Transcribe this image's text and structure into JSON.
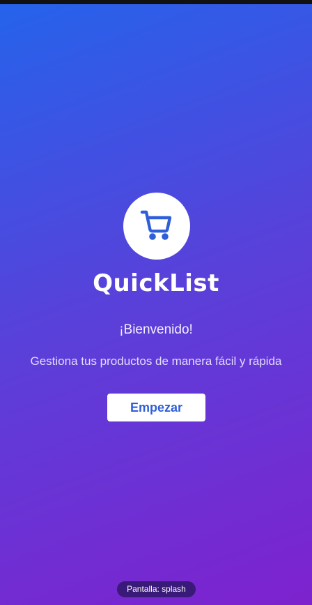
{
  "app": {
    "title": "QuickList",
    "logo_icon": "shopping-cart-icon"
  },
  "splash": {
    "welcome": "¡Bienvenido!",
    "subtitle": "Gestiona tus productos de manera fácil y rápida",
    "start_button": "Empezar"
  },
  "footer": {
    "screen_label": "Pantalla: splash"
  },
  "colors": {
    "gradient_start": "#2563eb",
    "gradient_end": "#7e22ce",
    "accent": "#2f5fd8",
    "badge_bg": "#3a1a78"
  }
}
